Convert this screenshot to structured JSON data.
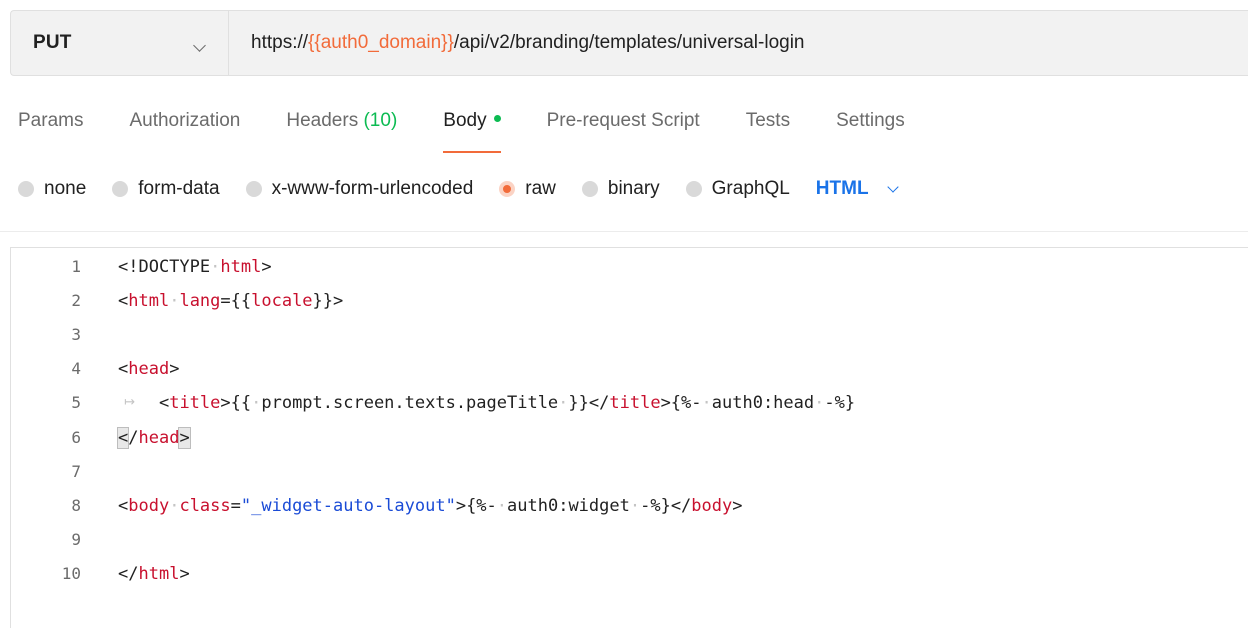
{
  "request": {
    "method": "PUT",
    "url_prefix": "https://",
    "url_variable": "{{auth0_domain}}",
    "url_suffix": "/api/v2/branding/templates/universal-login"
  },
  "tabs": [
    {
      "label": "Params"
    },
    {
      "label": "Authorization"
    },
    {
      "label": "Headers",
      "count": "(10)"
    },
    {
      "label": "Body",
      "active": true
    },
    {
      "label": "Pre-request Script"
    },
    {
      "label": "Tests"
    },
    {
      "label": "Settings"
    }
  ],
  "body_types": [
    {
      "label": "none"
    },
    {
      "label": "form-data"
    },
    {
      "label": "x-www-form-urlencoded"
    },
    {
      "label": "raw",
      "selected": true
    },
    {
      "label": "binary"
    },
    {
      "label": "GraphQL"
    }
  ],
  "language": "HTML",
  "colors": {
    "accent": "#f26b3a",
    "green": "#0cbb52",
    "blue": "#1a73e8"
  },
  "editor": {
    "line_numbers": [
      "1",
      "2",
      "3",
      "4",
      "5",
      "6",
      "7",
      "8",
      "9",
      "10"
    ],
    "lines": [
      [
        [
          "pl",
          "<!DOCTYPE"
        ],
        [
          "ws",
          "·"
        ],
        [
          "tag",
          "html"
        ],
        [
          "pl",
          ">"
        ]
      ],
      [
        [
          "pl",
          "<"
        ],
        [
          "tag",
          "html"
        ],
        [
          "ws",
          "·"
        ],
        [
          "attr",
          "lang"
        ],
        [
          "pl",
          "={{"
        ],
        [
          "tag",
          "locale"
        ],
        [
          "pl",
          "}}>"
        ]
      ],
      [],
      [
        [
          "pl",
          "<"
        ],
        [
          "tag",
          "head"
        ],
        [
          "pl",
          ">"
        ]
      ],
      [
        [
          "ws",
          "    "
        ],
        [
          "pl",
          "<"
        ],
        [
          "tag",
          "title"
        ],
        [
          "pl",
          ">{{"
        ],
        [
          "ws",
          "·"
        ],
        [
          "pl",
          "prompt.screen.texts.pageTitle"
        ],
        [
          "ws",
          "·"
        ],
        [
          "pl",
          "}}</"
        ],
        [
          "tag",
          "title"
        ],
        [
          "pl",
          ">{%-"
        ],
        [
          "ws",
          "·"
        ],
        [
          "pl",
          "auth0:head"
        ],
        [
          "ws",
          "·"
        ],
        [
          "pl",
          "-%}"
        ]
      ],
      [
        [
          "bm",
          "<"
        ],
        [
          "pl",
          "/"
        ],
        [
          "tag",
          "head"
        ],
        [
          "bm",
          ">"
        ]
      ],
      [],
      [
        [
          "pl",
          "<"
        ],
        [
          "tag",
          "body"
        ],
        [
          "ws",
          "·"
        ],
        [
          "attr",
          "class"
        ],
        [
          "pl",
          "="
        ],
        [
          "str",
          "\"_widget-auto-layout\""
        ],
        [
          "pl",
          ">{%-"
        ],
        [
          "ws",
          "·"
        ],
        [
          "pl",
          "auth0:widget"
        ],
        [
          "ws",
          "·"
        ],
        [
          "pl",
          "-%}</"
        ],
        [
          "tag",
          "body"
        ],
        [
          "pl",
          ">"
        ]
      ],
      [],
      [
        [
          "pl",
          "</"
        ],
        [
          "tag",
          "html"
        ],
        [
          "pl",
          ">"
        ]
      ]
    ]
  }
}
